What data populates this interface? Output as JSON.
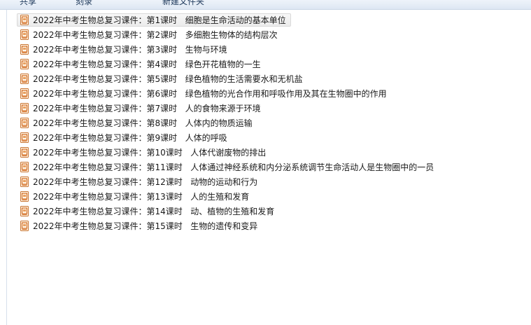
{
  "toolbar": {
    "items": [
      {
        "label": "共享"
      },
      {
        "label": "刻录"
      },
      {
        "label": "新建文件夹"
      }
    ]
  },
  "files": [
    {
      "name": "2022年中考生物总复习课件：第1课时   细胞是生命活动的基本单位",
      "selected": true,
      "icon": "powerpoint-file-icon"
    },
    {
      "name": "2022年中考生物总复习课件：第2课时   多细胞生物体的结构层次",
      "selected": false,
      "icon": "powerpoint-file-icon"
    },
    {
      "name": "2022年中考生物总复习课件：第3课时   生物与环境",
      "selected": false,
      "icon": "powerpoint-file-icon"
    },
    {
      "name": "2022年中考生物总复习课件：第4课时   绿色开花植物的一生",
      "selected": false,
      "icon": "powerpoint-file-icon"
    },
    {
      "name": "2022年中考生物总复习课件：第5课时   绿色植物的生活需要水和无机盐",
      "selected": false,
      "icon": "powerpoint-file-icon"
    },
    {
      "name": "2022年中考生物总复习课件：第6课时   绿色植物的光合作用和呼吸作用及其在生物圈中的作用",
      "selected": false,
      "icon": "powerpoint-file-icon"
    },
    {
      "name": "2022年中考生物总复习课件：第7课时   人的食物来源于环境",
      "selected": false,
      "icon": "powerpoint-file-icon"
    },
    {
      "name": "2022年中考生物总复习课件：第8课时   人体内的物质运输",
      "selected": false,
      "icon": "powerpoint-file-icon"
    },
    {
      "name": "2022年中考生物总复习课件：第9课时   人体的呼吸",
      "selected": false,
      "icon": "powerpoint-file-icon"
    },
    {
      "name": "2022年中考生物总复习课件：第10课时   人体代谢废物的排出",
      "selected": false,
      "icon": "powerpoint-file-icon"
    },
    {
      "name": "2022年中考生物总复习课件：第11课时   人体通过神经系统和内分泌系统调节生命活动人是生物圈中的一员",
      "selected": false,
      "icon": "powerpoint-file-icon"
    },
    {
      "name": "2022年中考生物总复习课件：第12课时   动物的运动和行为",
      "selected": false,
      "icon": "powerpoint-file-icon"
    },
    {
      "name": "2022年中考生物总复习课件：第13课时   人的生殖和发育",
      "selected": false,
      "icon": "powerpoint-file-icon"
    },
    {
      "name": "2022年中考生物总复习课件：第14课时   动、植物的生殖和发育",
      "selected": false,
      "icon": "powerpoint-file-icon"
    },
    {
      "name": "2022年中考生物总复习课件：第15课时   生物的遗传和变异",
      "selected": false,
      "icon": "powerpoint-file-icon"
    }
  ],
  "colors": {
    "icon_orange": "#d2691e",
    "selection_border": "#d9d9d9",
    "text": "#1a1a1a"
  }
}
